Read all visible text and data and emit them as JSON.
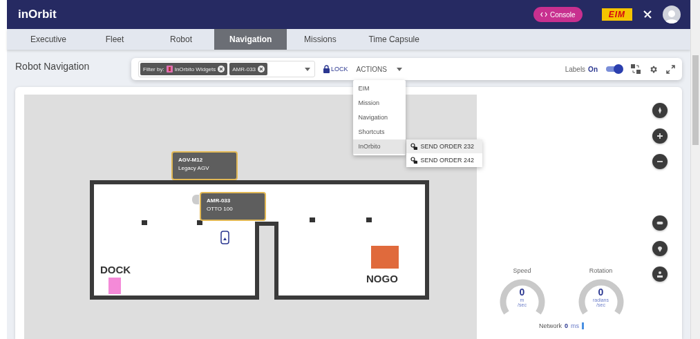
{
  "header": {
    "logo": "inOrbit",
    "console_button": "Console",
    "partner_logo": "EIM"
  },
  "tabs": [
    {
      "label": "Executive",
      "selected": false
    },
    {
      "label": "Fleet",
      "selected": false
    },
    {
      "label": "Robot",
      "selected": false
    },
    {
      "label": "Navigation",
      "selected": true
    },
    {
      "label": "Missions",
      "selected": false
    },
    {
      "label": "Time Capsule",
      "selected": false
    }
  ],
  "page_title": "Robot Navigation",
  "toolbar": {
    "filter_label": "Filter by:",
    "chips": [
      {
        "kind": "widget",
        "label": "InOrbito Widgets"
      },
      {
        "kind": "plain",
        "label": "AMR-033"
      }
    ],
    "lock": "LOCK",
    "actions": "ACTIONS",
    "labels": {
      "label": "Labels",
      "state": "On",
      "on": true
    }
  },
  "actions_menu": {
    "items": [
      {
        "label": "EIM",
        "selected": false
      },
      {
        "label": "Mission",
        "selected": false
      },
      {
        "label": "Navigation",
        "selected": false
      },
      {
        "label": "Shortcuts",
        "selected": false
      },
      {
        "label": "InOrbito",
        "selected": true
      }
    ],
    "submenu": [
      {
        "label": "SEND ORDER 232",
        "selected": true
      },
      {
        "label": "SEND ORDER 242",
        "selected": false
      }
    ]
  },
  "map": {
    "dock": "DOCK",
    "nogo": "NOGO",
    "robots": [
      {
        "name": "AGV-M12",
        "model": "Legacy AGV"
      },
      {
        "name": "AMR-033",
        "model": "OTTO 100"
      }
    ]
  },
  "gauges": [
    {
      "label": "Speed",
      "value": "0",
      "unit": "m",
      "per": "/sec"
    },
    {
      "label": "Rotation",
      "value": "0",
      "unit": "radians",
      "per": "/sec"
    }
  ],
  "network": {
    "label": "Network",
    "value": "0",
    "unit": "ms"
  }
}
